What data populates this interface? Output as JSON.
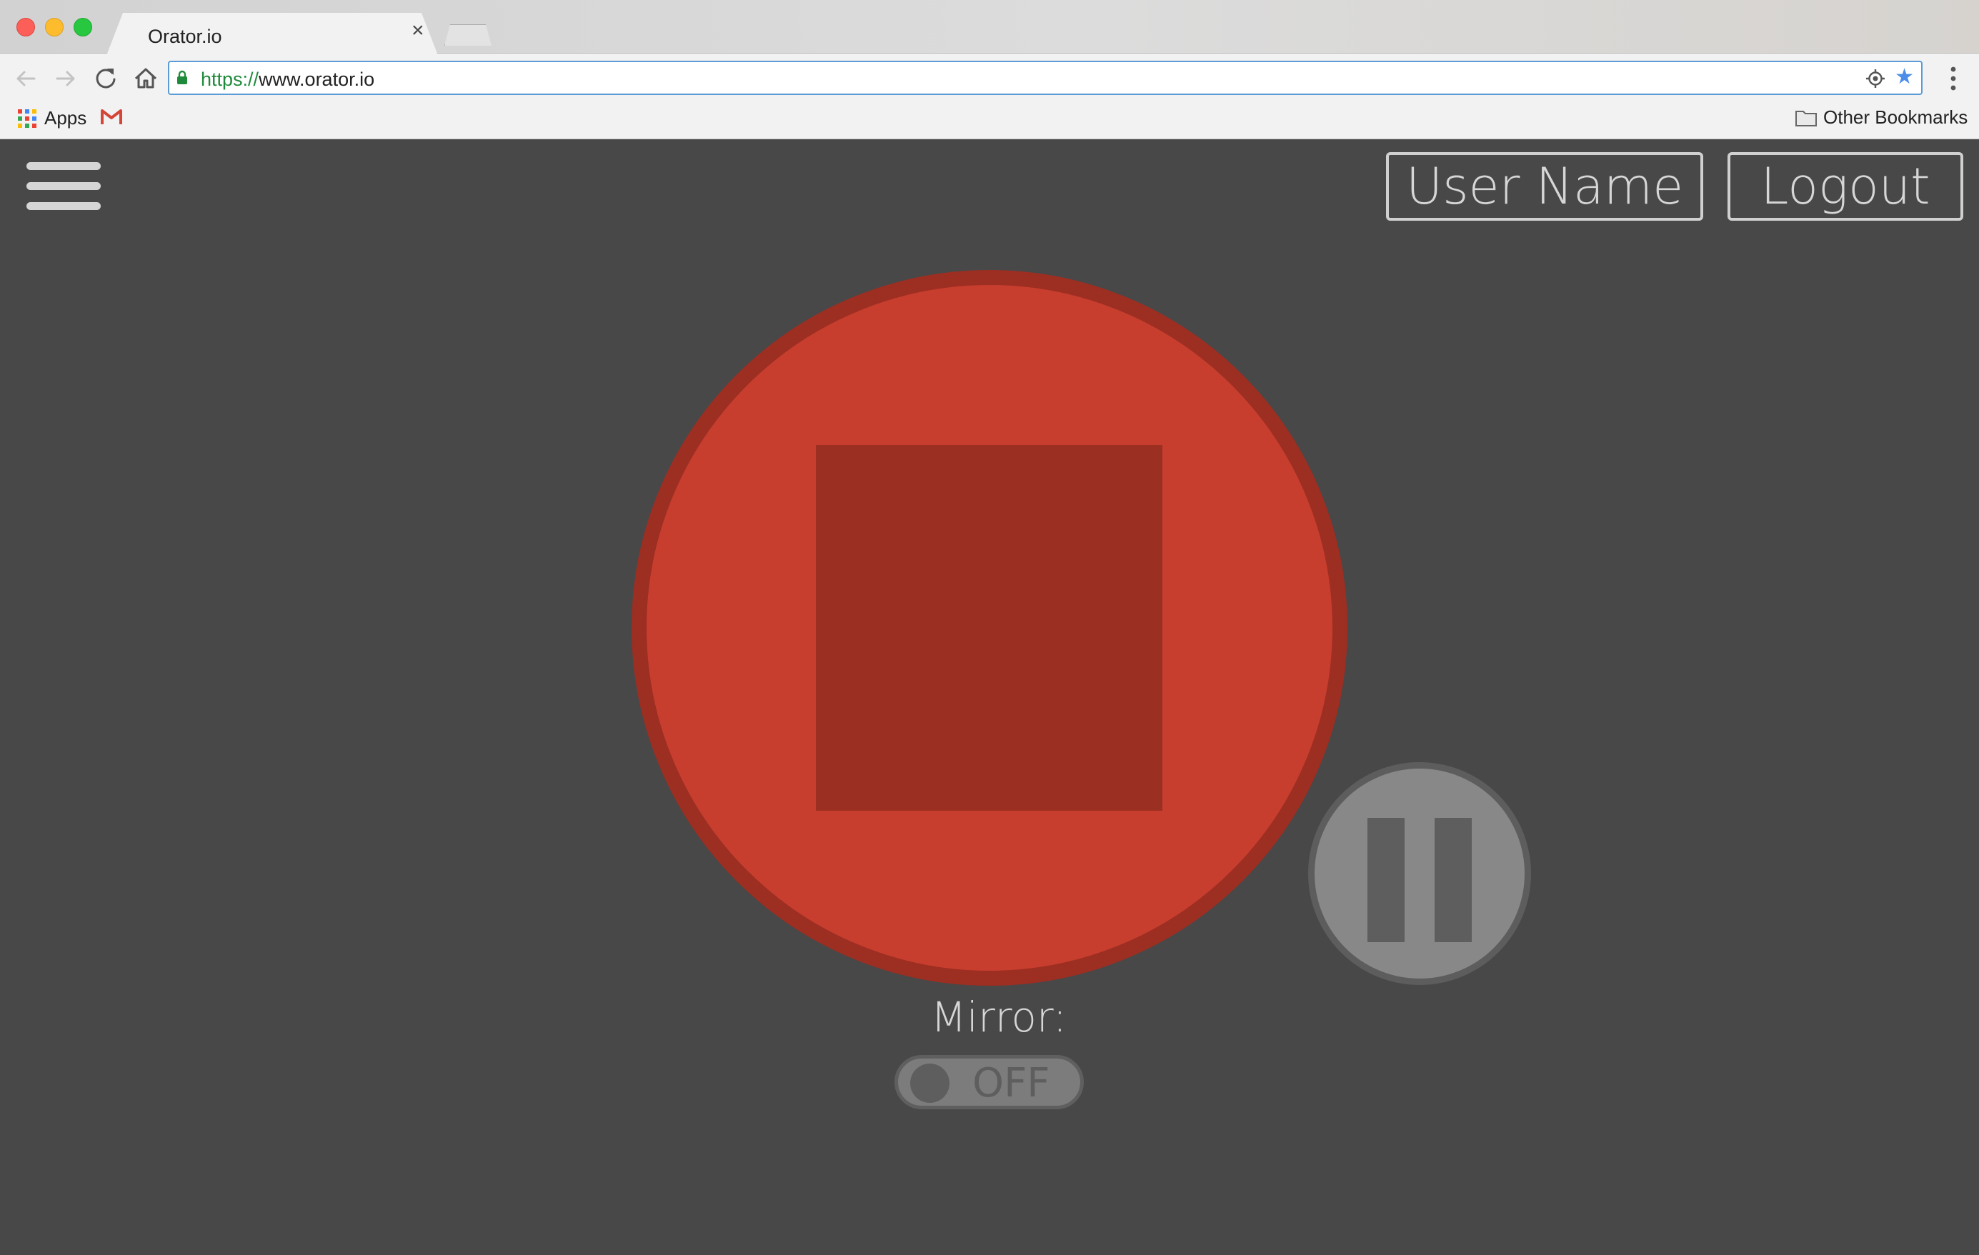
{
  "browser": {
    "tab_title": "Orator.io",
    "tab_close_glyph": "×",
    "url_scheme": "https://",
    "url_rest": "www.orator.io",
    "bookmarks": {
      "apps_label": "Apps",
      "other_label": "Other Bookmarks"
    },
    "icons": [
      "back-arrow-icon",
      "forward-arrow-icon",
      "reload-icon",
      "home-icon",
      "lock-icon",
      "location-icon",
      "star-icon",
      "menu-dots-icon",
      "apps-grid-icon",
      "gmail-icon",
      "folder-icon"
    ]
  },
  "app": {
    "menu_icon": "hamburger-icon",
    "user_button": "User Name",
    "logout_button": "Logout",
    "record_control": "stop-icon",
    "pause_control": "pause-icon",
    "mirror_label": "Mirror:",
    "mirror_toggle": "OFF"
  },
  "colors": {
    "background": "#484848",
    "stop_fill": "#c73e2e",
    "stop_border": "#9d2e22",
    "pause_fill": "#888888",
    "accent_url_border": "#5b9bd6",
    "secure_green": "#1f8a3b"
  }
}
